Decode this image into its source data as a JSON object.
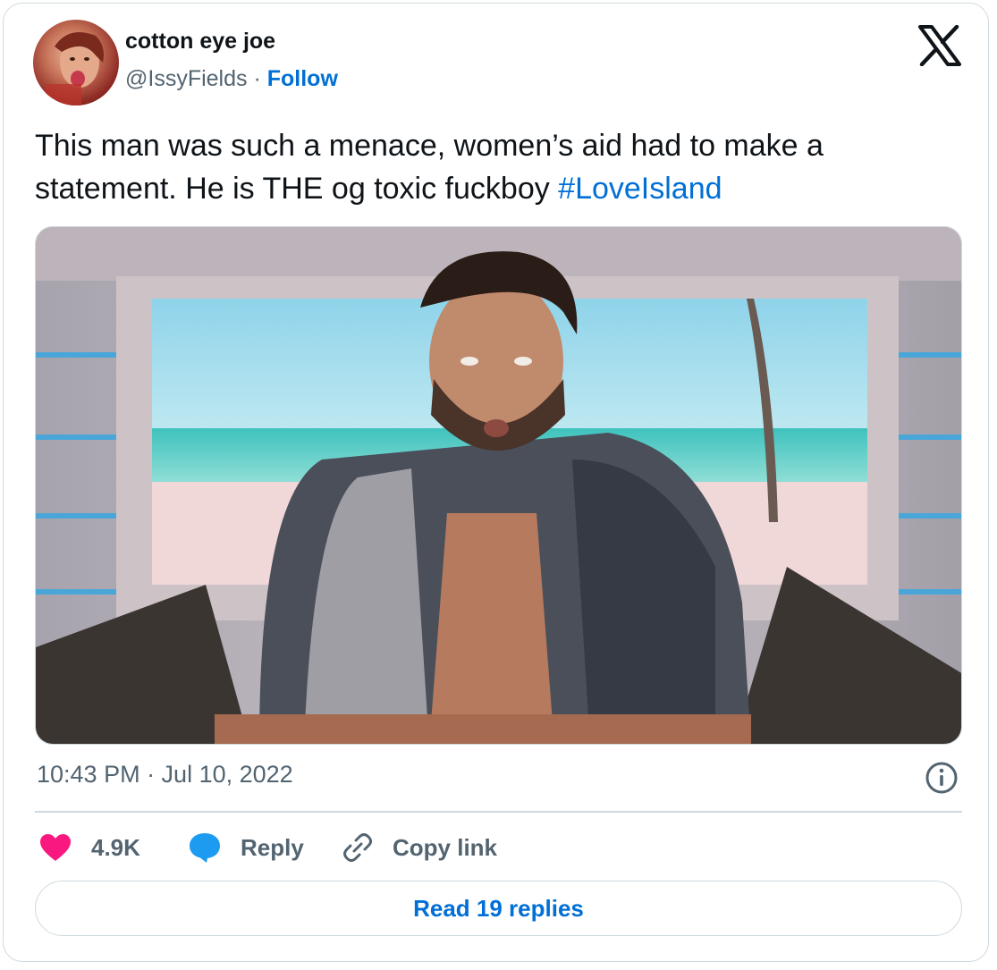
{
  "author": {
    "display_name": "cotton eye joe",
    "handle": "@IssyFields",
    "separator": "·",
    "follow_label": "Follow"
  },
  "tweet": {
    "text_before": "This man was such a menace, women’s aid had to make a statement. He is THE og toxic fuckboy ",
    "hashtag": "#LoveIsland",
    "timestamp": "10:43 PM · Jul 10, 2022"
  },
  "actions": {
    "like_count": "4.9K",
    "reply_label": "Reply",
    "copy_link_label": "Copy link"
  },
  "footer": {
    "read_replies_label": "Read 19 replies"
  },
  "icons": {
    "logo": "x-logo-icon",
    "like": "heart-icon",
    "reply": "speech-bubble-icon",
    "copy": "link-icon",
    "info": "info-icon"
  },
  "colors": {
    "link_blue": "#006fd6",
    "like_pink": "#f91880",
    "muted_text": "#536471",
    "border": "#cfd9de",
    "reply_blue": "#1d9bf0"
  }
}
